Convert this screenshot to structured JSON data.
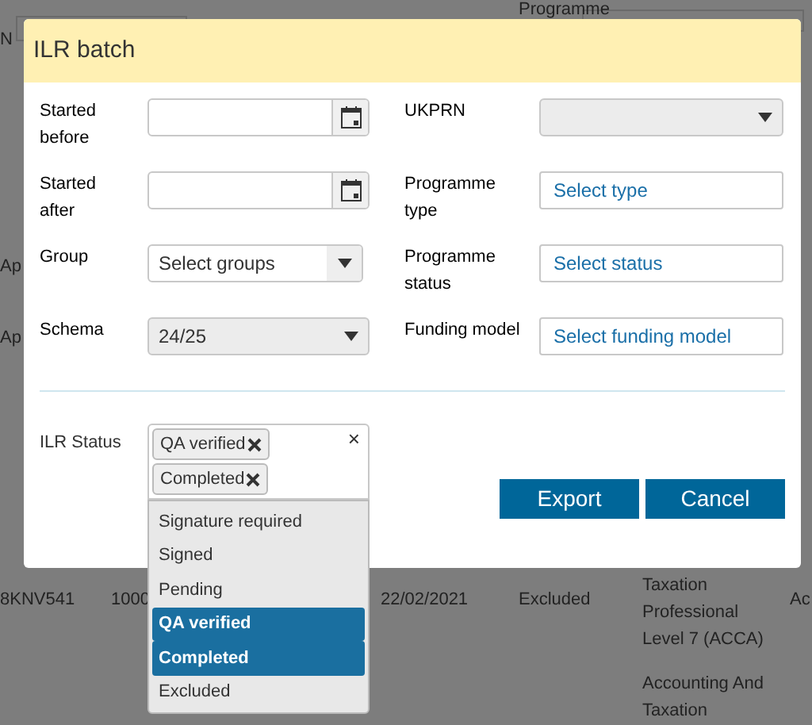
{
  "background": {
    "texts": [
      "N",
      "Programme",
      "Ap",
      "Ap"
    ],
    "rows": [
      {
        "cells": [
          "8KNV541",
          "1000",
          "22/02/2021",
          "Excluded",
          "Taxation Professional Level 7 (ACCA)",
          "Ac"
        ]
      },
      {
        "cells": [
          "",
          "",
          "",
          "",
          "Accounting And Taxation",
          ""
        ]
      }
    ]
  },
  "dialog": {
    "title": "ILR batch",
    "rows": [
      {
        "left": {
          "label": "Started before",
          "kind": "date"
        },
        "right": {
          "label": "UKPRN",
          "kind": "select"
        }
      },
      {
        "left": {
          "label": "Started after",
          "kind": "date"
        },
        "right": {
          "label": "Programme type",
          "kind": "picker",
          "placeholder": "Select type"
        }
      },
      {
        "left": {
          "label": "Group",
          "kind": "multiselect",
          "placeholder": "Select groups"
        },
        "right": {
          "label": "Programme status",
          "kind": "picker",
          "placeholder": "Select status"
        }
      },
      {
        "left": {
          "label": "Schema",
          "kind": "select",
          "value": "24/25"
        },
        "right": {
          "label": "Funding model",
          "kind": "picker",
          "placeholder": "Select funding model"
        }
      }
    ],
    "ilr_status": {
      "label": "ILR Status",
      "tags": [
        "QA verified",
        "Completed"
      ],
      "clear": "×",
      "options": [
        {
          "label": "Signature required",
          "selected": false
        },
        {
          "label": "Signed",
          "selected": false
        },
        {
          "label": "Pending",
          "selected": false
        },
        {
          "label": "QA verified",
          "selected": true
        },
        {
          "label": "Completed",
          "selected": true
        },
        {
          "label": "Excluded",
          "selected": false
        }
      ]
    },
    "buttons": [
      "Export",
      "Cancel"
    ]
  }
}
